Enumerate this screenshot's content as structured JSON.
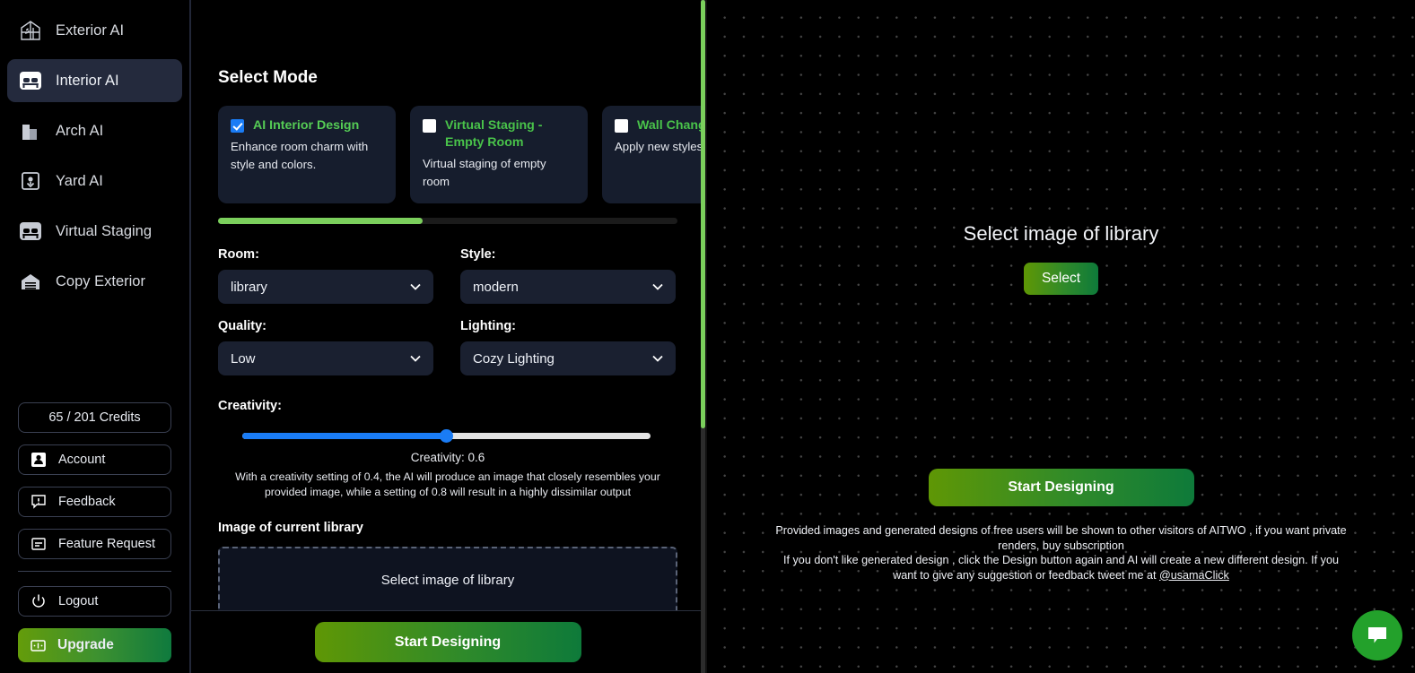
{
  "sidebar": {
    "nav": [
      {
        "label": "Exterior AI",
        "icon": "greenhouse-icon",
        "active": false
      },
      {
        "label": "Interior AI",
        "icon": "bed-icon",
        "active": true
      },
      {
        "label": "Arch AI",
        "icon": "building-icon",
        "active": false
      },
      {
        "label": "Yard AI",
        "icon": "plant-box-icon",
        "active": false
      },
      {
        "label": "Virtual Staging",
        "icon": "bed-icon",
        "active": false
      },
      {
        "label": "Copy Exterior",
        "icon": "garage-icon",
        "active": false
      }
    ],
    "credits": "65 / 201 Credits",
    "account": "Account",
    "feedback": "Feedback",
    "feature_request": "Feature Request",
    "logout": "Logout",
    "upgrade": "Upgrade"
  },
  "panel": {
    "select_mode_title": "Select Mode",
    "modes": [
      {
        "title": "AI Interior Design",
        "desc": "Enhance room charm with style and colors.",
        "checked": true
      },
      {
        "title": "Virtual Staging - Empty Room",
        "desc": "Virtual staging of empty room",
        "checked": false
      },
      {
        "title": "Wall Changer",
        "desc": "Apply new styles an walls",
        "checked": false
      }
    ],
    "fields": {
      "room_label": "Room:",
      "room_value": "library",
      "style_label": "Style:",
      "style_value": "modern",
      "quality_label": "Quality:",
      "quality_value": "Low",
      "lighting_label": "Lighting:",
      "lighting_value": "Cozy Lighting"
    },
    "creativity": {
      "label": "Creativity:",
      "value_text": "Creativity: 0.6",
      "help": "With a creativity setting of 0.4, the AI will produce an image that closely resembles your provided image, while a setting of 0.8 will result in a highly dissimilar output"
    },
    "image_section_label": "Image of current library",
    "dropzone_text": "Select image of library",
    "start_designing": "Start Designing"
  },
  "canvas": {
    "title": "Select image of library",
    "select_button": "Select",
    "start_designing": "Start Designing",
    "note_line1": "Provided images and generated designs of free users will be shown to other visitors of AITWO , if you want private renders, buy subscription",
    "note_line2_pre": "If you don't like generated design , click the Design button again and AI will create a new different design. If you want to give any suggestion or feedback tweet me at ",
    "note_handle": "@usamaClick"
  },
  "colors": {
    "accent_green": "#7bcf5c",
    "brand_green_text": "#49c34a",
    "checkbox_blue": "#1a7cf5",
    "slider_blue": "#1a7cf5",
    "card_bg": "#161d2d",
    "chat_green": "#23a12b"
  }
}
